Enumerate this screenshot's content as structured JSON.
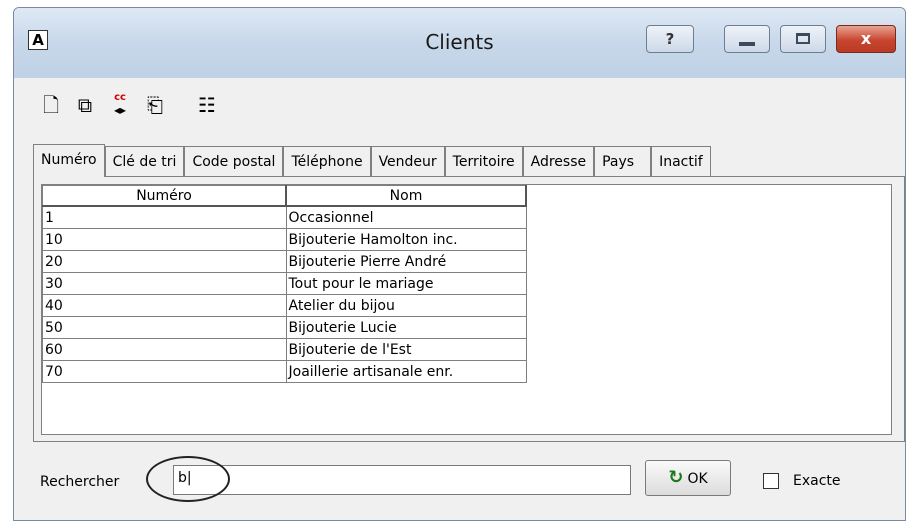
{
  "window": {
    "title": "Clients",
    "app_icon": "A",
    "buttons": {
      "help": "?",
      "close": "x"
    }
  },
  "toolbar": {
    "icons": [
      "new-document-icon",
      "copy-window-icon",
      "cc-arrows-icon",
      "export-icon",
      "properties-icon"
    ],
    "cc_label": "cc"
  },
  "tabs": [
    "Numéro",
    "Clé de tri",
    "Code postal",
    "Téléphone",
    "Vendeur",
    "Territoire",
    "Adresse",
    "Pays",
    "Inactif"
  ],
  "table": {
    "columns": [
      "Numéro",
      "Nom"
    ],
    "rows": [
      [
        "1",
        "Occasionnel"
      ],
      [
        "10",
        "Bijouterie Hamolton inc."
      ],
      [
        "20",
        "Bijouterie Pierre André"
      ],
      [
        "30",
        "Tout pour le mariage"
      ],
      [
        "40",
        "Atelier du bijou"
      ],
      [
        "50",
        "Bijouterie Lucie"
      ],
      [
        "60",
        "Bijouterie de l'Est"
      ],
      [
        "70",
        "Joaillerie artisanale enr."
      ]
    ]
  },
  "search": {
    "label": "Rechercher",
    "value": "b|",
    "ok_label": "OK",
    "exact_label": "Exacte"
  }
}
